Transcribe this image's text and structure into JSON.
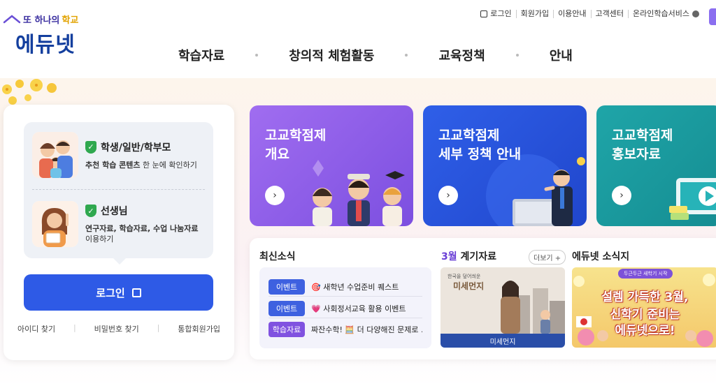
{
  "logo": {
    "tagline_prefix": "또 하나의",
    "tagline_accent": "학교",
    "name": "에듀넷"
  },
  "util_nav": {
    "login": "로그인",
    "signup": "회원가입",
    "guide": "이용안내",
    "support": "고객센터",
    "online": "온라인학습서비스"
  },
  "gnb": [
    "학습자료",
    "창의적 체험활동",
    "교육정책",
    "안내"
  ],
  "login_panel": {
    "student": {
      "title": "학생/일반/학부모",
      "desc_bold": "추천 학습 콘텐츠",
      "desc_rest": " 한 눈에 확인하기"
    },
    "teacher": {
      "title": "선생님",
      "desc_bold": "연구자료, 학습자료, 수업 나눔자료",
      "desc_rest": "이용하기"
    },
    "login_button": "로그인",
    "links": [
      "아이디 찾기",
      "비밀번호 찾기",
      "통합회원가입"
    ]
  },
  "cards": [
    {
      "line1": "고교학점제",
      "line2": "개요"
    },
    {
      "line1": "고교학점제",
      "line2": "세부 정책 안내"
    },
    {
      "line1": "고교학점제",
      "line2": "홍보자료"
    }
  ],
  "news": {
    "title": "최신소식",
    "items": [
      {
        "tag": "이벤트",
        "icon": "🎯",
        "text": "새학년 수업준비 퀘스트"
      },
      {
        "tag": "이벤트",
        "icon": "💗",
        "text": "사회정서교육 활용 이벤트"
      },
      {
        "tag": "학습자료",
        "icon": "",
        "text": "짜잔수학! 🧮 더 다양해진 문제로 ..."
      }
    ]
  },
  "monthly": {
    "month": "3월",
    "title": " 계기자료",
    "more": "더보기 +",
    "thumb_mini": "한국을 덮어씌운",
    "thumb_big": "미세먼지",
    "thumb_caption": "미세먼지"
  },
  "newsletter": {
    "title": "에듀넷 소식지",
    "ribbon": "두근두근 새학기 시작",
    "line1": "설렘 가득한 3월,",
    "line2": "신학기 준비는",
    "line3": "에듀넷으로!"
  }
}
